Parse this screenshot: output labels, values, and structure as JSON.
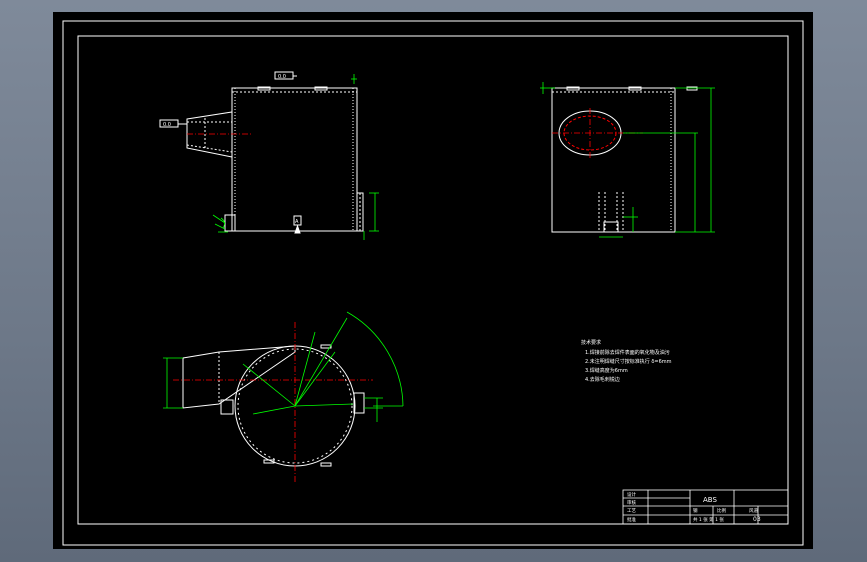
{
  "drawing": {
    "background": "#000000",
    "colors": {
      "outline": "#ffffff",
      "dimension": "#00ff00",
      "center_line": "#ff0000",
      "note_text": "#ffffff"
    },
    "view_labels": {
      "front_flange_tag": "0.0",
      "front_inlet_tag": "0.0",
      "front_bottom_tag": "A"
    },
    "technical_notes": {
      "heading": "技术要求",
      "items": [
        "1.焊接前除去焊件表面的氧化物及油污",
        "2.未注明焊缝尺寸按标准执行  δ=6mm",
        "3.焊缝高度为6mm",
        "4.去除毛刺锐边"
      ]
    },
    "title_block": {
      "part_name": "ABS",
      "drawing_no": "03",
      "scale_label": "比例",
      "sheet_label": "共 1 张  第 1 张",
      "material": "钢",
      "rows": [
        "设计",
        "审核",
        "工艺",
        "批准"
      ],
      "company": "风道"
    }
  }
}
